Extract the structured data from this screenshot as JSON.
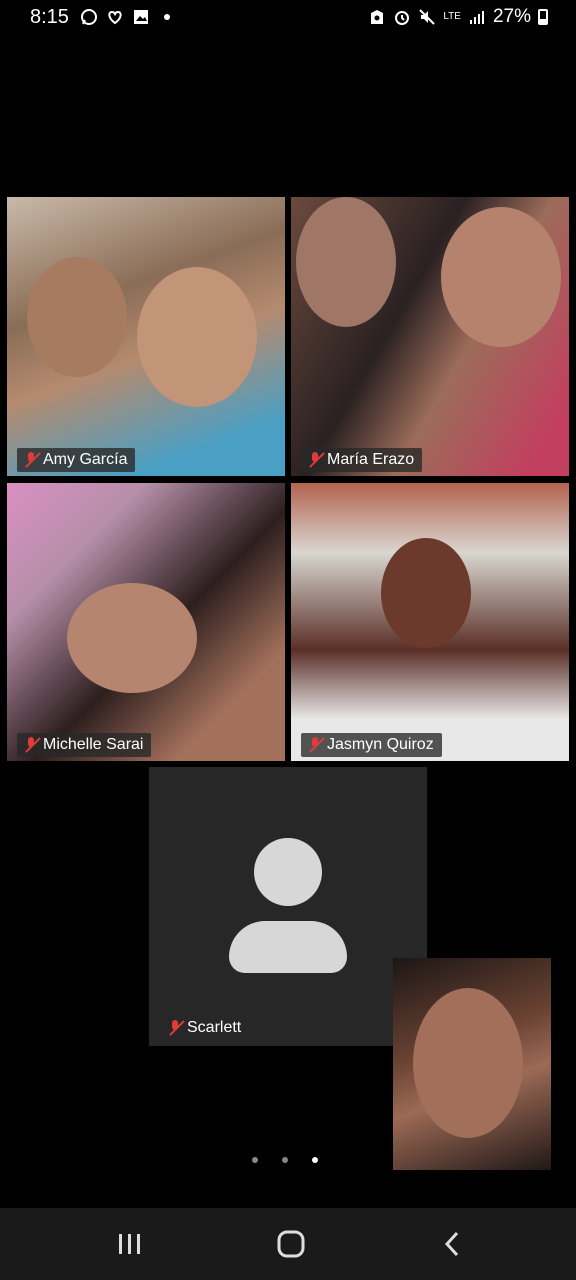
{
  "status_bar": {
    "time": "8:15",
    "left_icons": [
      "whatsapp-icon",
      "heart-icon",
      "image-icon",
      "dot-icon"
    ],
    "right_icons": [
      "alarm-lock-icon",
      "alarm-clock-icon",
      "mute-icon",
      "lte-icon",
      "signal-icon"
    ],
    "lte_label": "LTE",
    "battery": "27%"
  },
  "participants": [
    {
      "name": "Amy García",
      "muted": true
    },
    {
      "name": "María Erazo",
      "muted": true
    },
    {
      "name": "Michelle Sarai",
      "muted": true
    },
    {
      "name": "Jasmyn Quiroz",
      "muted": true
    },
    {
      "name": "Scarlett",
      "muted": true,
      "video": false
    }
  ],
  "pagination": {
    "pages": 3,
    "active": 3
  },
  "nav_bar": {
    "buttons": [
      "recent-apps-icon",
      "home-icon",
      "back-icon"
    ]
  },
  "colors": {
    "background": "#000000",
    "muted_mic": "#e03b3b",
    "avatar_tile": "#272727",
    "avatar_fill": "#d7d7d7",
    "nav_bar": "#1a1a1a"
  }
}
